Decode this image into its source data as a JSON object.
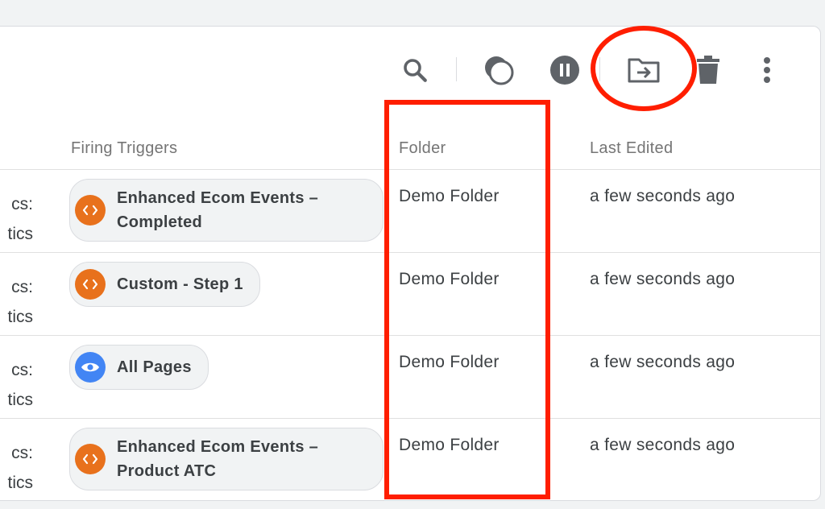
{
  "columns": {
    "firing_triggers": "Firing Triggers",
    "folder": "Folder",
    "last_edited": "Last Edited"
  },
  "toolbar": {
    "icons": [
      "search-icon",
      "overlap-circles-icon",
      "pause-icon",
      "move-to-folder-icon",
      "delete-icon",
      "more-vert-icon"
    ]
  },
  "colors": {
    "custom_event_trigger": "#e8711c",
    "pageview_trigger": "#4285f4",
    "annotation": "#ff1e00"
  },
  "rows": [
    {
      "type_lines": [
        "cs:",
        "tics"
      ],
      "trigger": {
        "label": "Enhanced Ecom Events – Completed",
        "icon": "code-icon",
        "kind": "custom"
      },
      "folder": "Demo Folder",
      "last_edited": "a few seconds ago"
    },
    {
      "type_lines": [
        "cs:",
        "tics"
      ],
      "trigger": {
        "label": "Custom - Step 1",
        "icon": "code-icon",
        "kind": "custom"
      },
      "folder": "Demo Folder",
      "last_edited": "a few seconds ago"
    },
    {
      "type_lines": [
        "cs:",
        "tics"
      ],
      "trigger": {
        "label": "All Pages",
        "icon": "eye-icon",
        "kind": "pageview"
      },
      "folder": "Demo Folder",
      "last_edited": "a few seconds ago"
    },
    {
      "type_lines": [
        "cs:",
        "tics"
      ],
      "trigger": {
        "label": "Enhanced Ecom Events – Product ATC",
        "icon": "code-icon",
        "kind": "custom"
      },
      "folder": "Demo Folder",
      "last_edited": "a few seconds ago"
    }
  ]
}
